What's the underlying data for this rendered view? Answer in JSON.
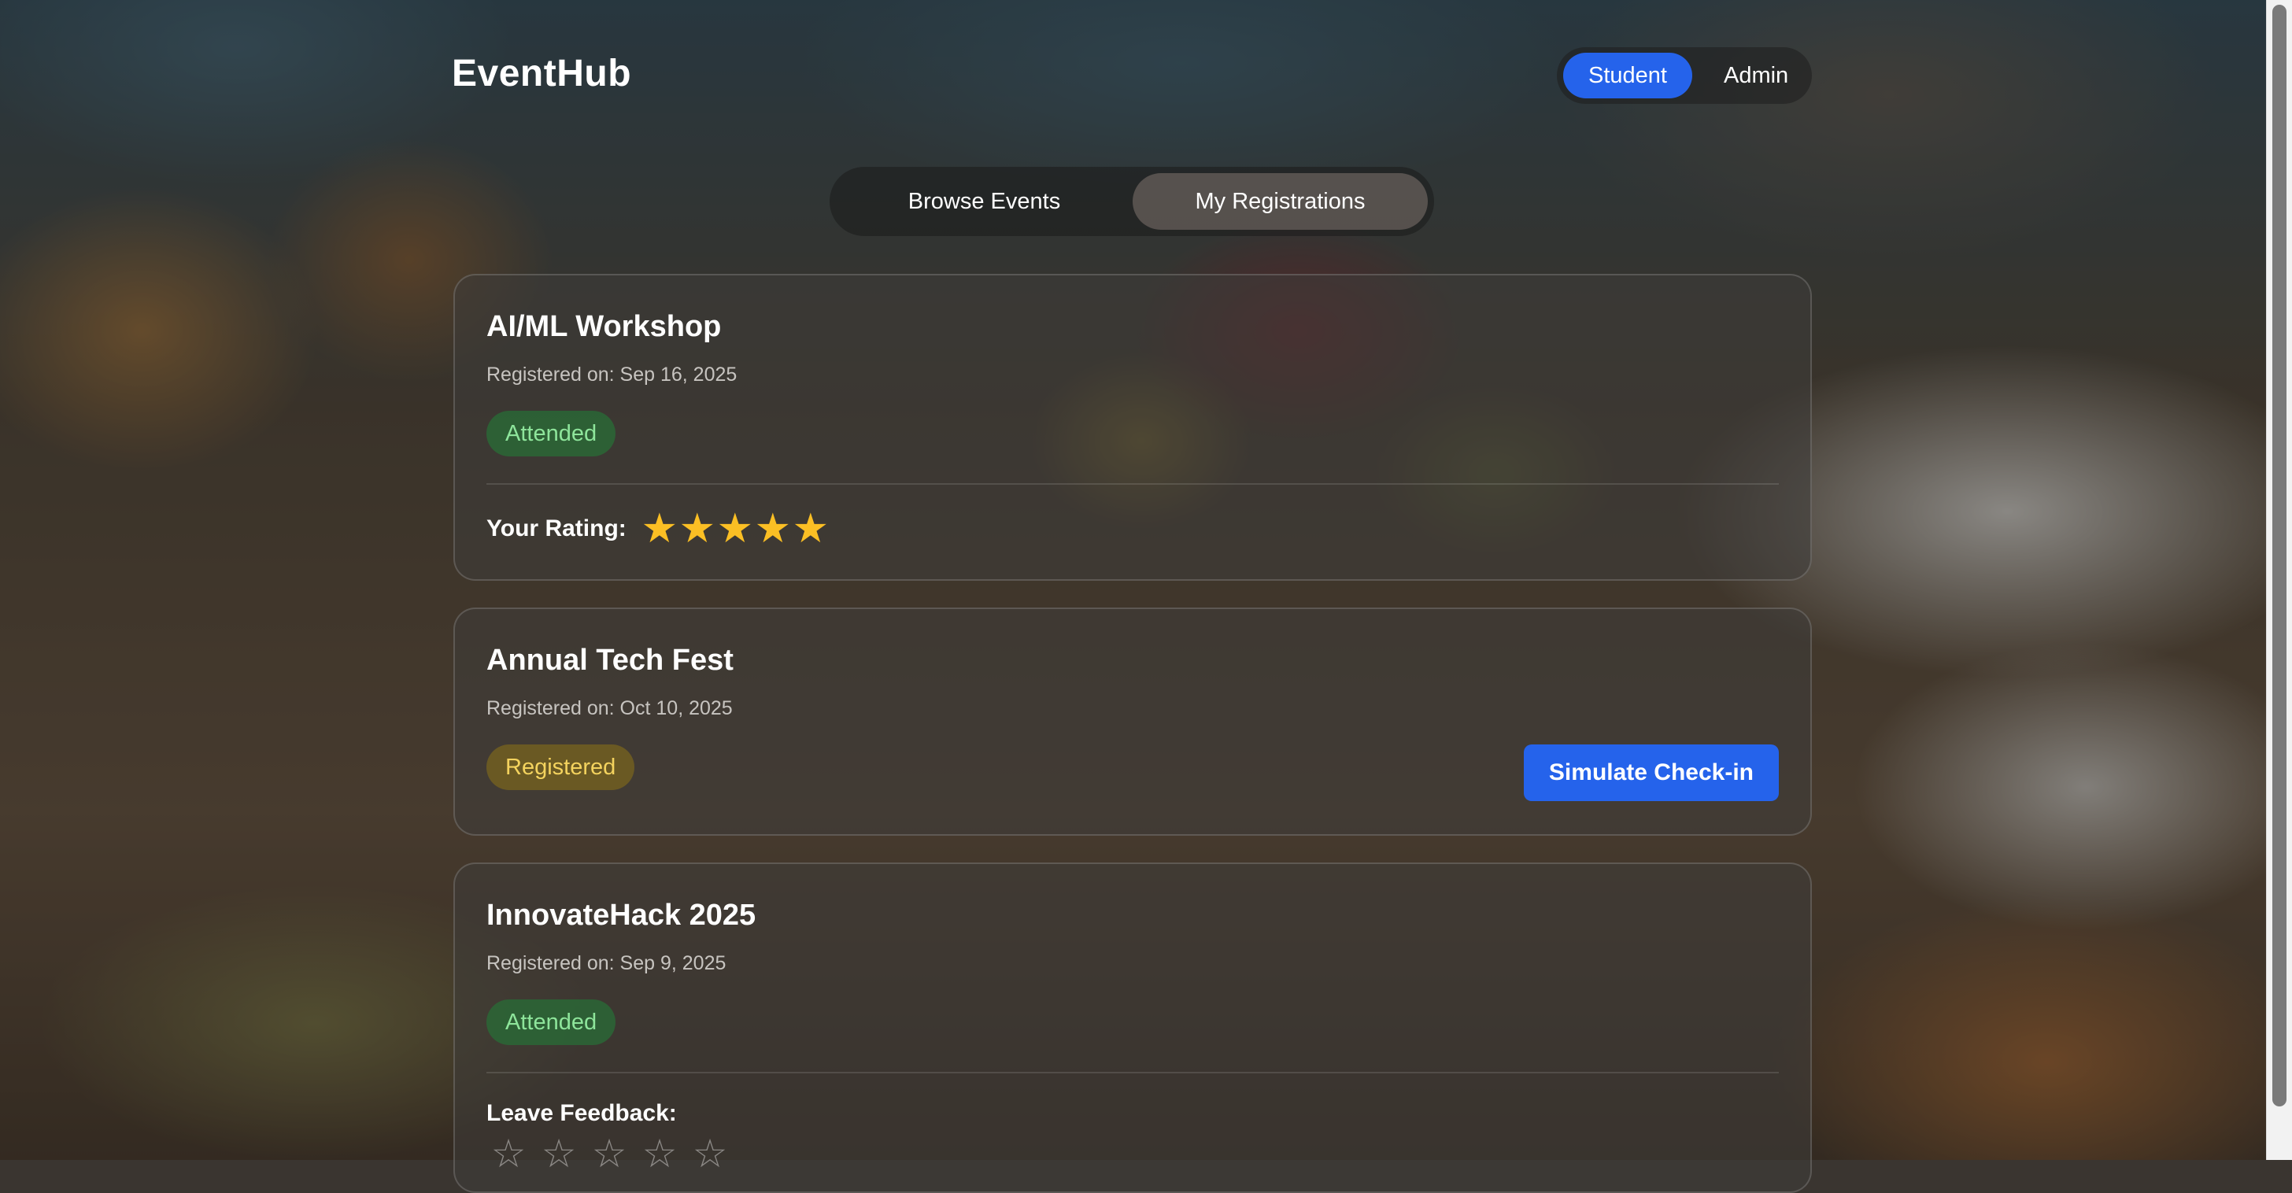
{
  "app": {
    "brand": "EventHub"
  },
  "role_switch": {
    "student": "Student",
    "admin": "Admin",
    "active": "Student"
  },
  "tabs": {
    "browse": "Browse Events",
    "mine": "My Registrations",
    "active": "My Registrations"
  },
  "registrations": [
    {
      "title": "AI/ML Workshop",
      "registered_on": "Registered on: Sep 16, 2025",
      "status": "Attended",
      "rating_label": "Your Rating:",
      "rating": 5,
      "stars": "★★★★★"
    },
    {
      "title": "Annual Tech Fest",
      "registered_on": "Registered on: Oct 10, 2025",
      "status": "Registered",
      "action": "Simulate Check-in"
    },
    {
      "title": "InnovateHack 2025",
      "registered_on": "Registered on: Sep 9, 2025",
      "status": "Attended",
      "feedback_label": "Leave Feedback:",
      "feedback_stars": "☆☆☆☆☆"
    }
  ],
  "colors": {
    "accent": "#2563eb",
    "attended_text": "#8ee59b",
    "registered_text": "#f4d35e",
    "star": "#fbbf24"
  }
}
